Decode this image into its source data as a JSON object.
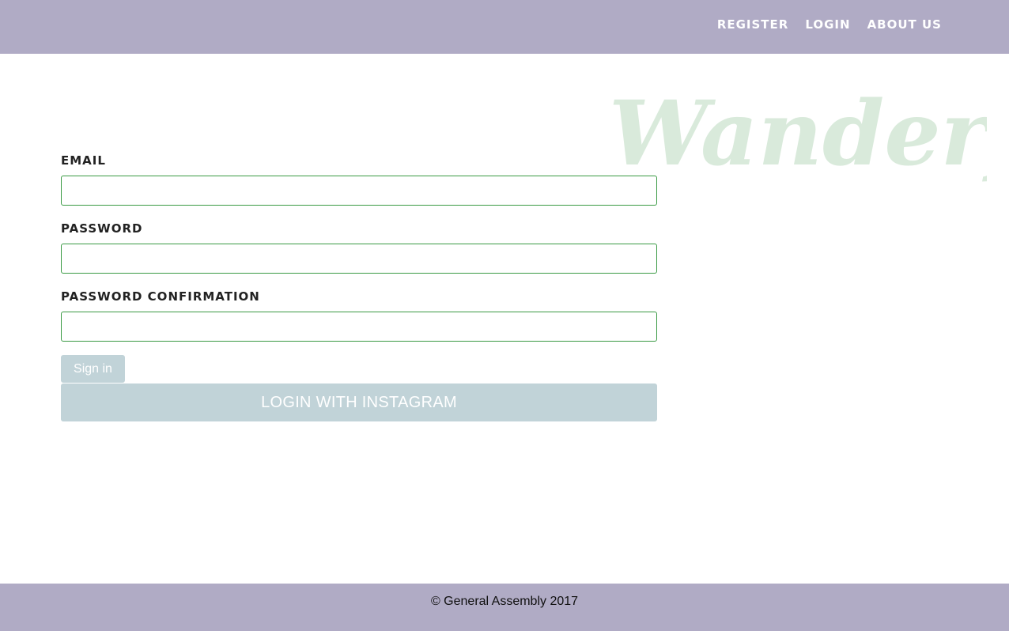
{
  "nav": {
    "items": [
      {
        "label": "REGISTER"
      },
      {
        "label": "LOGIN"
      },
      {
        "label": "ABOUT US"
      }
    ]
  },
  "brand": {
    "logo_text": "Wanderful",
    "logo_color": "#d9eadb"
  },
  "form": {
    "email_label": "EMAIL",
    "email_value": "",
    "password_label": "PASSWORD",
    "password_value": "",
    "password_confirmation_label": "PASSWORD CONFIRMATION",
    "password_confirmation_value": "",
    "signin_label": "Sign in",
    "instagram_label": "LOGIN WITH INSTAGRAM"
  },
  "footer": {
    "copyright": "© General Assembly 2017"
  },
  "colors": {
    "header_bg": "#b0abc5",
    "footer_bg": "#b0abc5",
    "button_bg": "#c1d3d8",
    "input_border": "#3a9a44"
  }
}
